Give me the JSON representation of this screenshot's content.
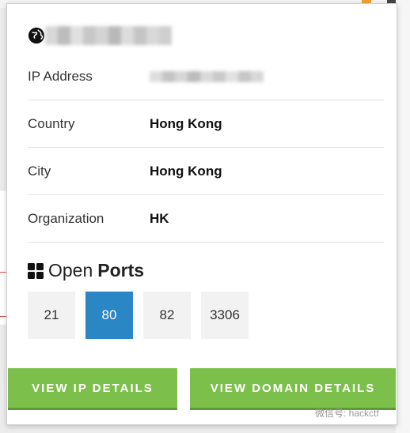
{
  "popup": {
    "rows": [
      {
        "label": "IP Address",
        "value": ""
      },
      {
        "label": "Country",
        "value": "Hong Kong"
      },
      {
        "label": "City",
        "value": "Hong Kong"
      },
      {
        "label": "Organization",
        "value": "HK"
      }
    ],
    "ports_title": {
      "prefix": "Open",
      "bold": "Ports"
    },
    "ports": [
      {
        "label": "21",
        "active": false
      },
      {
        "label": "80",
        "active": true
      },
      {
        "label": "82",
        "active": false
      },
      {
        "label": "3306",
        "active": false
      }
    ],
    "buttons": {
      "ip_details": "VIEW IP DETAILS",
      "domain_details": "VIEW DOMAIN DETAILS"
    }
  },
  "watermark": "微信号: hackctf",
  "colors": {
    "accent": "#2a86c4",
    "button": "#7cc04b"
  }
}
